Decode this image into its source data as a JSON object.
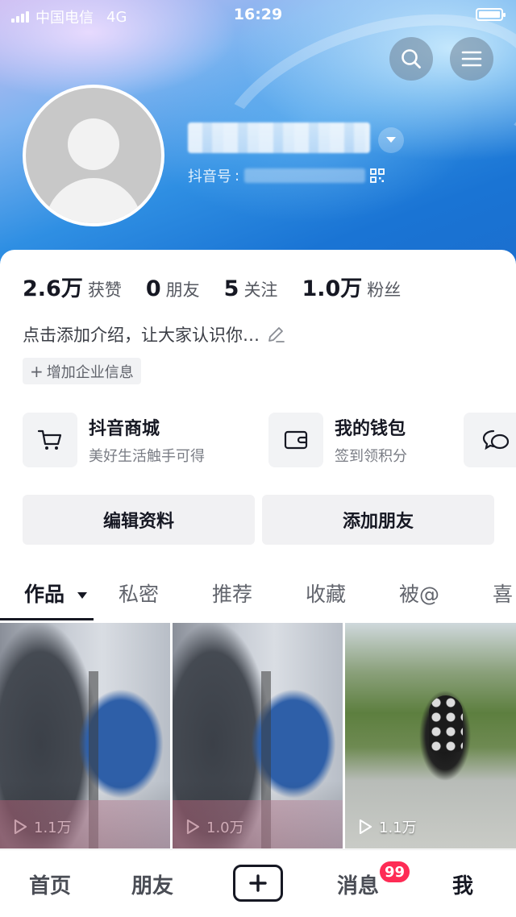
{
  "status_bar": {
    "carrier": "中国电信",
    "network": "4G",
    "time": "16:29"
  },
  "header": {
    "search_icon": "search-icon",
    "menu_icon": "menu-icon",
    "douyin_id_label": "抖音号"
  },
  "stats": [
    {
      "value": "2.6万",
      "label": "获赞"
    },
    {
      "value": "0",
      "label": "朋友"
    },
    {
      "value": "5",
      "label": "关注"
    },
    {
      "value": "1.0万",
      "label": "粉丝"
    }
  ],
  "bio": {
    "text": "点击添加介绍，让大家认识你…"
  },
  "enterprise_tag": {
    "label": "增加企业信息"
  },
  "services": [
    {
      "title": "抖音商城",
      "subtitle": "美好生活触手可得",
      "icon": "cart-icon"
    },
    {
      "title": "我的钱包",
      "subtitle": "签到领积分",
      "icon": "wallet-icon"
    },
    {
      "title": "",
      "subtitle": "",
      "icon": "chat-icon"
    }
  ],
  "actions": {
    "edit_profile": "编辑资料",
    "add_friends": "添加朋友"
  },
  "tabs": [
    "作品",
    "私密",
    "推荐",
    "收藏",
    "被@",
    "喜"
  ],
  "videos": [
    {
      "plays": "1.1万"
    },
    {
      "plays": "1.0万"
    },
    {
      "plays": "1.1万"
    }
  ],
  "bottom_nav": {
    "home": "首页",
    "friends": "朋友",
    "messages": "消息",
    "messages_badge": "99",
    "me": "我"
  },
  "colors": {
    "accent": "#fe2c55",
    "text": "#161823",
    "banner": "#2f8fe3"
  }
}
